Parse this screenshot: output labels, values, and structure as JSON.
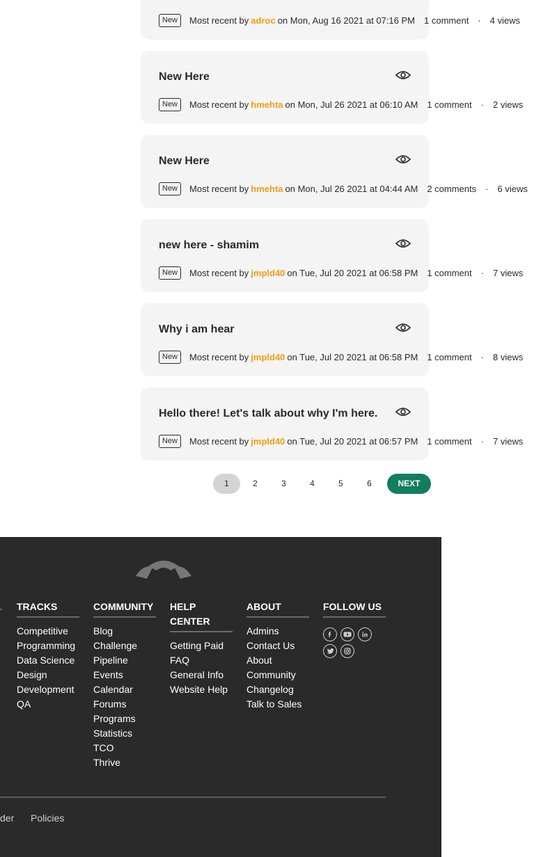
{
  "threads": [
    {
      "title": "",
      "badge": "New",
      "recent_prefix": "Most recent by",
      "user": "adroc",
      "date": "on Mon, Aug 16 2021 at 07:16 PM",
      "comments": "1 comment",
      "views": "4 views"
    },
    {
      "title": "New Here",
      "badge": "New",
      "recent_prefix": "Most recent by",
      "user": "hmehta",
      "date": "on Mon, Jul 26 2021 at 06:10 AM",
      "comments": "1 comment",
      "views": "2 views"
    },
    {
      "title": "New Here",
      "badge": "New",
      "recent_prefix": "Most recent by",
      "user": "hmehta",
      "date": "on Mon, Jul 26 2021 at 04:44 AM",
      "comments": "2 comments",
      "views": "6 views"
    },
    {
      "title": "new here - shamim",
      "badge": "New",
      "recent_prefix": "Most recent by",
      "user": "jmpld40",
      "date": "on Tue, Jul 20 2021 at 06:58 PM",
      "comments": "1 comment",
      "views": "7 views"
    },
    {
      "title": "Why i am hear",
      "badge": "New",
      "recent_prefix": "Most recent by",
      "user": "jmpld40",
      "date": "on Tue, Jul 20 2021 at 06:58 PM",
      "comments": "1 comment",
      "views": "8 views"
    },
    {
      "title": "Hello there! Let's talk about why I'm here.",
      "badge": "New",
      "recent_prefix": "Most recent by",
      "user": "jmpld40",
      "date": "on Tue, Jul 20 2021 at 06:57 PM",
      "comments": "1 comment",
      "views": "7 views"
    }
  ],
  "separator": "·",
  "pagination": {
    "pages": [
      "1",
      "2",
      "3",
      "4",
      "5",
      "6"
    ],
    "current": "1",
    "next": "NEXT"
  },
  "footer": {
    "tracks": {
      "heading": "TRACKS",
      "links": [
        "Competitive Programming",
        "Data Science",
        "Design",
        "Development",
        "QA"
      ]
    },
    "community": {
      "heading": "COMMUNITY",
      "links": [
        "Blog",
        "Challenge Pipeline",
        "Events Calendar",
        "Forums",
        "Programs",
        "Statistics",
        "TCO",
        "Thrive"
      ]
    },
    "help": {
      "heading": "HELP CENTER",
      "links": [
        "Getting Paid",
        "FAQ",
        "General Info",
        "Website Help"
      ]
    },
    "about": {
      "heading": "ABOUT",
      "links": [
        "Admins",
        "Contact Us",
        "About Community",
        "Changelog",
        "Talk to Sales"
      ]
    },
    "follow": {
      "heading": "FOLLOW US",
      "icons": [
        "facebook-icon",
        "youtube-icon",
        "linkedin-icon",
        "twitter-icon",
        "instagram-icon"
      ]
    },
    "bottom_links": [
      "der",
      "Policies"
    ]
  },
  "colors": {
    "username": "#f39d14",
    "next_button": "#137d60",
    "footer_bg": "#2a2a2a",
    "card_bg": "#f4f4f4"
  }
}
